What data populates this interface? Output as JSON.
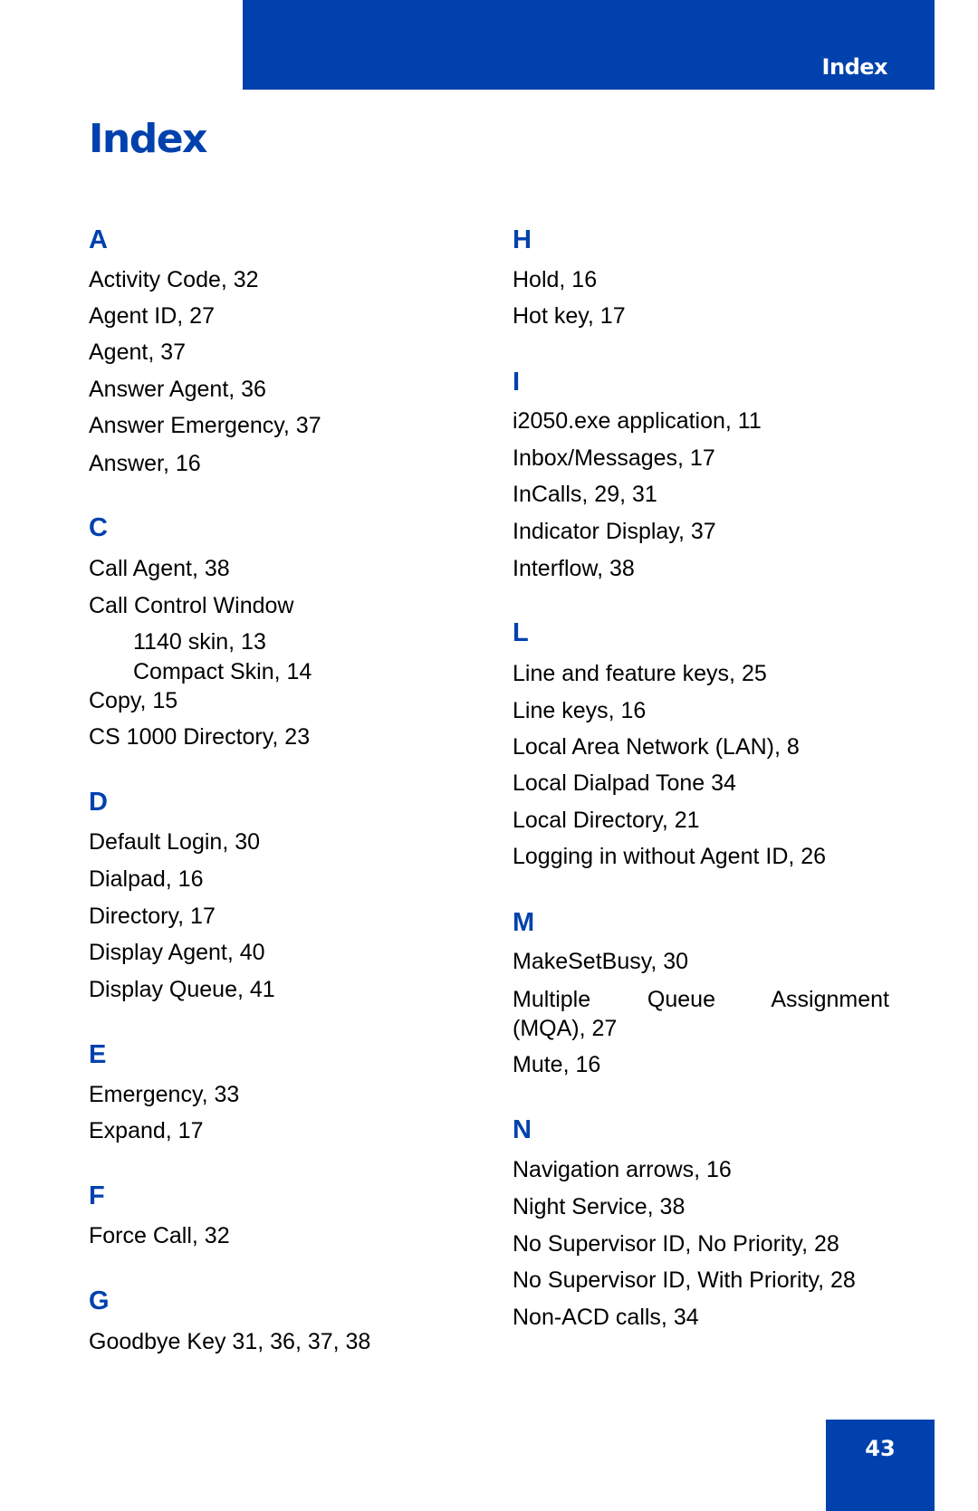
{
  "header": {
    "section_label": "Index",
    "accent_color": "#0041ad"
  },
  "title": "Index",
  "left_column": {
    "groups": [
      {
        "letter": "A",
        "entries": [
          "Activity Code, 32",
          "Agent ID, 27",
          "Agent, 37",
          "Answer Agent, 36",
          "Answer Emergency, 37",
          "Answer, 16"
        ]
      },
      {
        "letter": "C",
        "entries": [
          "Call Agent, 38",
          "Call Control Window"
        ],
        "subentries": [
          "1140 skin, 13",
          "Compact Skin, 14"
        ],
        "entries_after": [
          "Copy, 15",
          "CS 1000 Directory, 23"
        ]
      },
      {
        "letter": "D",
        "entries": [
          "Default Login, 30",
          "Dialpad, 16",
          "Directory, 17",
          "Display Agent, 40",
          "Display Queue, 41"
        ]
      },
      {
        "letter": "E",
        "entries": [
          "Emergency, 33",
          "Expand, 17"
        ]
      },
      {
        "letter": "F",
        "entries": [
          "Force Call, 32"
        ]
      },
      {
        "letter": "G",
        "entries": [
          "Goodbye Key 31, 36, 37, 38"
        ]
      }
    ]
  },
  "right_column": {
    "groups": [
      {
        "letter": "H",
        "entries": [
          "Hold, 16",
          "Hot key, 17"
        ]
      },
      {
        "letter": "I",
        "entries": [
          "i2050.exe application, 11",
          "Inbox/Messages, 17",
          "InCalls, 29, 31",
          "Indicator Display, 37",
          "Interflow, 38"
        ]
      },
      {
        "letter": "L",
        "entries": [
          "Line and feature keys, 25",
          "Line keys, 16",
          "Local Area Network (LAN), 8",
          "Local Dialpad Tone 34",
          "Local Directory, 21",
          "Logging in without Agent ID, 26"
        ]
      },
      {
        "letter": "M",
        "entries": [
          "MakeSetBusy, 30",
          "Multiple Queue Assignment",
          "(MQA), 27",
          "Mute, 16"
        ]
      },
      {
        "letter": "N",
        "entries": [
          "Navigation arrows, 16",
          "Night Service, 38",
          "No Supervisor ID, No Priority, 28",
          "No Supervisor ID, With Priority, 28",
          "Non-ACD calls, 34"
        ]
      }
    ]
  },
  "footer": {
    "page_number": "43"
  }
}
